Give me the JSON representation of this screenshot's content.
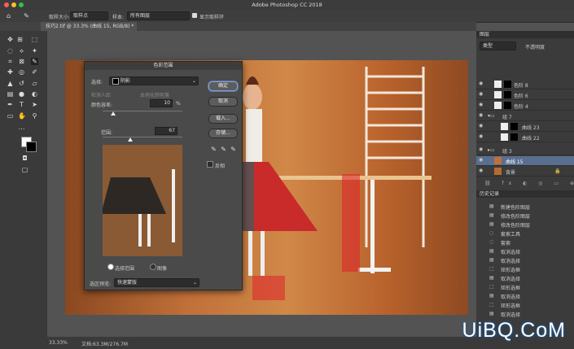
{
  "app": {
    "title": "Adobe Photoshop CC 2018",
    "window_buttons": [
      "close",
      "minimize",
      "maximize"
    ]
  },
  "options_bar": {
    "sample_size_label": "取样大小:",
    "sample_size_value": "取样点",
    "sample_label": "样本:",
    "sample_value": "所有图层",
    "show_ring_label": "显示取样环"
  },
  "document_tab": {
    "label": "技巧2.tif @ 33.3% (曲线 15, RGB/8) *"
  },
  "color_range_dialog": {
    "title": "色彩范围",
    "select_label": "选择:",
    "select_value": "阴影",
    "detect_faces_label": "检测人脸",
    "localized_label": "本地化颜色簇",
    "fuzziness_label": "颜色容差:",
    "fuzziness_value": "10",
    "fuzziness_unit": "%",
    "range_label": "范围:",
    "range_value": "67",
    "selection_radio": "选择范围",
    "image_radio": "图像",
    "preview_label": "选区预览:",
    "preview_value": "快速蒙版",
    "ok_button": "确定",
    "cancel_button": "取消",
    "load_button": "载入...",
    "save_button": "存储...",
    "invert_label": "反相"
  },
  "layers_panel": {
    "tab": "图层",
    "kind_label": "类型",
    "opacity_label": "不透明度",
    "layers": [
      {
        "name": "色阶 8",
        "type": "adjustment"
      },
      {
        "name": "色阶 6",
        "type": "adjustment"
      },
      {
        "name": "色阶 4",
        "type": "adjustment"
      },
      {
        "name": "组 7",
        "type": "group"
      },
      {
        "name": "曲线 23",
        "type": "adjustment"
      },
      {
        "name": "曲线 22",
        "type": "adjustment"
      },
      {
        "name": "组 3",
        "type": "group"
      },
      {
        "name": "曲线 15",
        "type": "adjustment",
        "selected": true
      },
      {
        "name": "背景",
        "type": "background"
      }
    ]
  },
  "history_panel": {
    "tab": "历史记录",
    "items": [
      "新建色阶图层",
      "修改色阶图层",
      "修改色阶图层",
      "套索工具",
      "套索",
      "取消选择",
      "取消选择",
      "矩形选框",
      "取消选择",
      "矩形选框",
      "取消选择",
      "矩形选框",
      "取消选择"
    ]
  },
  "status_bar": {
    "zoom": "33.33%",
    "doc_size": "文档:63.3M/276.7M"
  },
  "watermark": {
    "text": "UiBQ.CoM"
  },
  "colors": {
    "accent": "#5a7ab0",
    "panel_bg": "#3b3b3b",
    "selected_layer": "#5a6f8f",
    "red_mask": "#e0202a"
  }
}
